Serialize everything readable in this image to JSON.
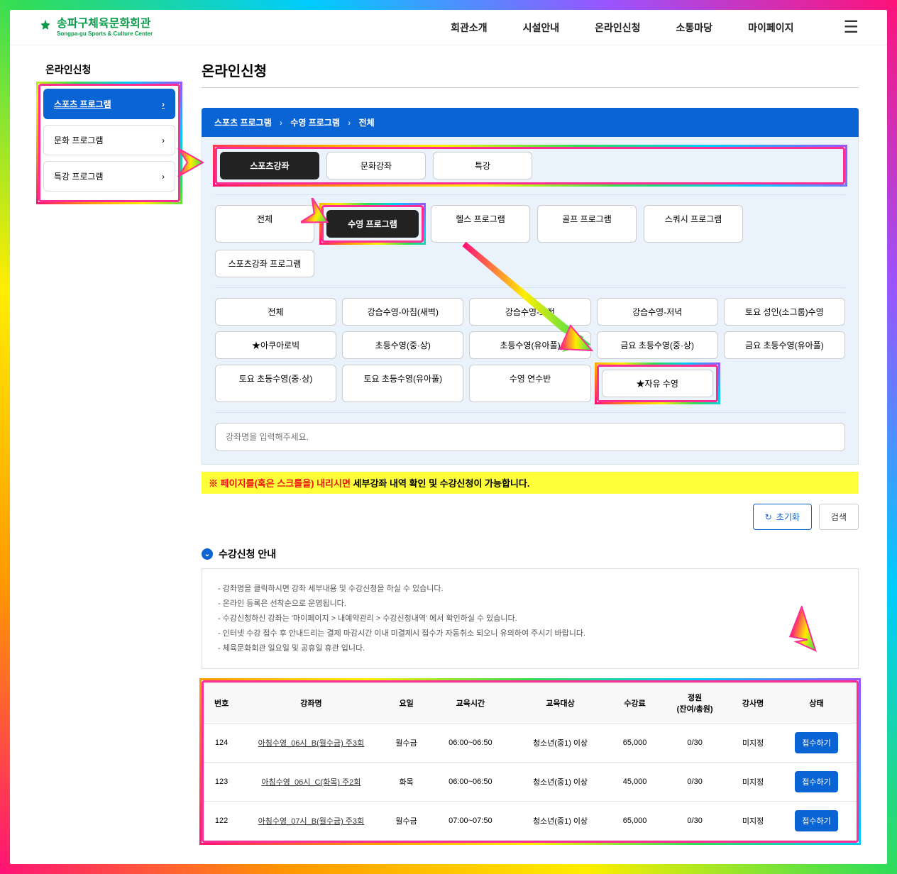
{
  "logo": {
    "title": "송파구체육문화회관",
    "sub": "Songpa-gu Sports & Culture Center"
  },
  "nav": [
    "회관소개",
    "시설안내",
    "온라인신청",
    "소통마당",
    "마이페이지"
  ],
  "sidebar": {
    "title": "온라인신청",
    "items": [
      {
        "label": "스포츠 프로그램",
        "active": true
      },
      {
        "label": "문화 프로그램",
        "active": false
      },
      {
        "label": "특강 프로그램",
        "active": false
      }
    ]
  },
  "page_title": "온라인신청",
  "breadcrumb": [
    "스포츠 프로그램",
    "수영 프로그램",
    "전체"
  ],
  "tabs_type": [
    {
      "label": "스포츠강좌",
      "active": true
    },
    {
      "label": "문화강좌",
      "active": false
    },
    {
      "label": "특강",
      "active": false
    }
  ],
  "tabs_program": [
    {
      "label": "전체",
      "active": false
    },
    {
      "label": "수영 프로그램",
      "active": true
    },
    {
      "label": "헬스 프로그램",
      "active": false
    },
    {
      "label": "골프 프로그램",
      "active": false
    },
    {
      "label": "스쿼시 프로그램",
      "active": false
    },
    {
      "label": "스포츠강좌 프로그램",
      "active": false
    }
  ],
  "filters": [
    "전체",
    "강습수영-아침(새벽)",
    "강습수영-오전",
    "강습수영-저녁",
    "토요 성인(소그룹)수영",
    "★아쿠아로빅",
    "초등수영(중·상)",
    "초등수영(유아풀)",
    "금요 초등수영(중·상)",
    "금요 초등수영(유아풀)",
    "토요 초등수영(중·상)",
    "토요 초등수영(유아풀)",
    "수영 연수반",
    "★자유 수영"
  ],
  "search": {
    "placeholder": "강좌명을 입력해주세요."
  },
  "notice": {
    "prefix": "※ 페이지를(혹은 스크롤을) ",
    "red": "내리시면",
    "suffix": " 세부강좌 내역 확인 및 수강신청이 가능합니다."
  },
  "buttons": {
    "reset": "초기화",
    "search": "검색",
    "apply": "접수하기"
  },
  "section_title": "수강신청 안내",
  "info_lines": [
    "- 강좌명을 클릭하시면 강좌 세부내용 및 수강신청을 하실 수 있습니다.",
    "- 온라인 등록은 선착순으로 운영됩니다.",
    "- 수강신청하신 강좌는 '마이페이지 > 내예약관리 > 수강신청내역' 에서 확인하실 수 있습니다.",
    "- 인터넷 수강 접수 후 안내드리는 결제 마감시간 이내 미결제시 접수가 자동취소 되오니 유의하여 주시기 바랍니다.",
    "- 체육문화회관 일요일 및 공휴일 휴관 입니다."
  ],
  "table": {
    "headers": [
      "번호",
      "강좌명",
      "요일",
      "교육시간",
      "교육대상",
      "수강료",
      "정원\n(잔여/총원)",
      "강사명",
      "상태"
    ],
    "rows": [
      {
        "no": "124",
        "name": "아침수영_06시_B(월수금) 주3회",
        "days": "월수금",
        "time": "06:00~06:50",
        "target": "청소년(중1) 이상",
        "fee": "65,000",
        "cap": "0/30",
        "teacher": "미지정"
      },
      {
        "no": "123",
        "name": "아침수영_06시_C(화목) 주2회",
        "days": "화목",
        "time": "06:00~06:50",
        "target": "청소년(중1) 이상",
        "fee": "45,000",
        "cap": "0/30",
        "teacher": "미지정"
      },
      {
        "no": "122",
        "name": "아침수영_07시_B(월수금) 주3회",
        "days": "월수금",
        "time": "07:00~07:50",
        "target": "청소년(중1) 이상",
        "fee": "65,000",
        "cap": "0/30",
        "teacher": "미지정"
      }
    ]
  }
}
